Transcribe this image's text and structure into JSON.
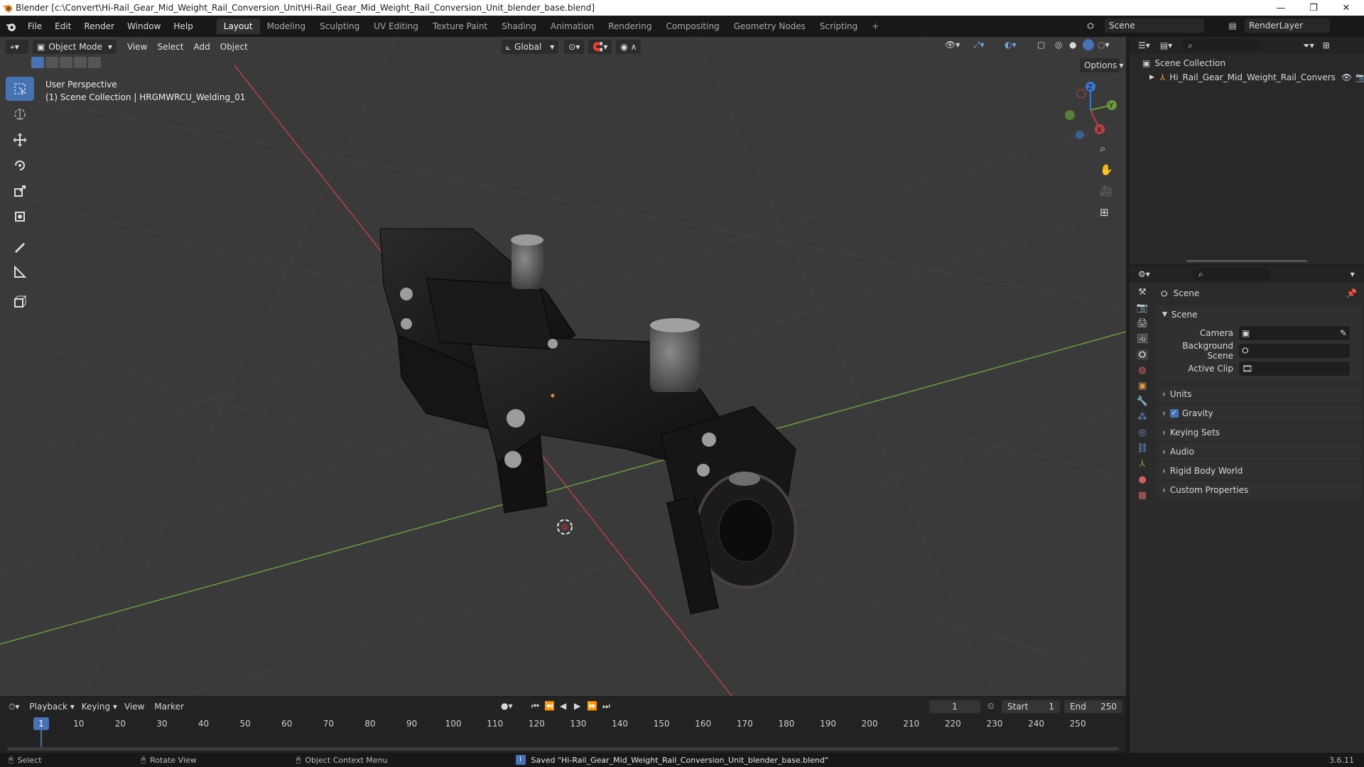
{
  "window": {
    "title": "Blender [c:\\Convert\\Hi-Rail_Gear_Mid_Weight_Rail_Conversion_Unit\\Hi-Rail_Gear_Mid_Weight_Rail_Conversion_Unit_blender_base.blend]"
  },
  "menu": {
    "items": [
      "File",
      "Edit",
      "Render",
      "Window",
      "Help"
    ],
    "workspaces": [
      "Layout",
      "Modeling",
      "Sculpting",
      "UV Editing",
      "Texture Paint",
      "Shading",
      "Animation",
      "Rendering",
      "Compositing",
      "Geometry Nodes",
      "Scripting"
    ],
    "active_workspace": "Layout",
    "scene_label": "Scene",
    "renderlayer_label": "RenderLayer"
  },
  "viewport": {
    "mode": "Object Mode",
    "menus": [
      "View",
      "Select",
      "Add",
      "Object"
    ],
    "transform_orientation": "Global",
    "options_label": "Options",
    "overlay_line1": "User Perspective",
    "overlay_line2": "(1) Scene Collection | HRGMWRCU_Welding_01",
    "gizmo_axes": [
      "X",
      "Y",
      "Z"
    ]
  },
  "outliner": {
    "root": "Scene Collection",
    "item": "Hi_Rail_Gear_Mid_Weight_Rail_Convers"
  },
  "properties": {
    "header": "Scene",
    "panel": "Scene",
    "fields": [
      {
        "label": "Camera"
      },
      {
        "label": "Background Scene"
      },
      {
        "label": "Active Clip"
      }
    ],
    "sections": [
      "Units",
      "Gravity",
      "Keying Sets",
      "Audio",
      "Rigid Body World",
      "Custom Properties"
    ],
    "gravity_checked": true,
    "version": "3.6.11"
  },
  "timeline": {
    "menus": [
      "Playback",
      "Keying",
      "View",
      "Marker"
    ],
    "current_frame": "1",
    "start_label": "Start",
    "start": "1",
    "end_label": "End",
    "end": "250",
    "ruler": [
      "1",
      "10",
      "20",
      "30",
      "40",
      "50",
      "60",
      "70",
      "80",
      "90",
      "100",
      "110",
      "120",
      "130",
      "140",
      "150",
      "160",
      "170",
      "180",
      "190",
      "200",
      "210",
      "220",
      "230",
      "240",
      "250"
    ]
  },
  "status": {
    "select": "Select",
    "rotate": "Rotate View",
    "context": "Object Context Menu",
    "message": "Saved \"Hi-Rail_Gear_Mid_Weight_Rail_Conversion_Unit_blender_base.blend\""
  },
  "colors": {
    "accent": "#4772b3",
    "x_axis": "#b84048",
    "y_axis": "#6a9a3c",
    "z_axis": "#3a78d0"
  }
}
